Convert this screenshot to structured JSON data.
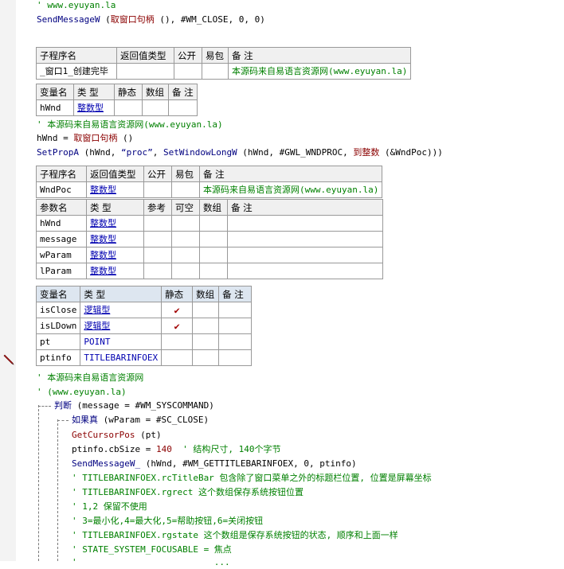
{
  "lines": {
    "l0": "' www.eyuyan.la",
    "l1a": "SendMessageW",
    "l1b": " (",
    "l1c": "取窗口句柄",
    "l1d": " (), ",
    "l1e": "#WM_CLOSE",
    "l1f": ", 0, 0)"
  },
  "table1": {
    "headers": [
      "子程序名",
      "返回值类型",
      "公开",
      "易包",
      "备 注"
    ],
    "name": "_窗口1_创建完毕",
    "note": "本源码来自易语言资源网(www.eyuyan.la)"
  },
  "vars1": {
    "headers": [
      "变量名",
      "类 型",
      "静态",
      "数组",
      "备 注"
    ],
    "rows": [
      {
        "name": "hWnd",
        "type": "整数型"
      }
    ]
  },
  "code2": {
    "c1": "' 本源码来自易语言资源网(www.eyuyan.la)",
    "c2a": "hWnd = ",
    "c2b": "取窗口句柄",
    "c2c": " ()",
    "c3a": "SetPropA",
    "c3b": " (hWnd, ",
    "c3c": "“proc”",
    "c3d": ", ",
    "c3e": "SetWindowLongW",
    "c3f": " (hWnd, ",
    "c3g": "#GWL_WNDPROC",
    "c3h": ", ",
    "c3i": "到整数",
    "c3j": " (&WndPoc)))"
  },
  "table2": {
    "headers": [
      "子程序名",
      "返回值类型",
      "公开",
      "易包",
      "备 注"
    ],
    "name": "WndPoc",
    "ret": "整数型",
    "note": "本源码来自易语言资源网(www.eyuyan.la)",
    "param_headers": [
      "参数名",
      "类 型",
      "参考",
      "可空",
      "数组",
      "备 注"
    ],
    "params": [
      {
        "name": "hWnd",
        "type": "整数型"
      },
      {
        "name": "message",
        "type": "整数型"
      },
      {
        "name": "wParam",
        "type": "整数型"
      },
      {
        "name": "lParam",
        "type": "整数型"
      }
    ]
  },
  "vars2": {
    "headers": [
      "变量名",
      "类 型",
      "静态",
      "数组",
      "备 注"
    ],
    "rows": [
      {
        "name": "isClose",
        "type": "逻辑型",
        "static": "✔"
      },
      {
        "name": "isLDown",
        "type": "逻辑型",
        "static": "✔"
      },
      {
        "name": "pt",
        "type": "POINT",
        "static": ""
      },
      {
        "name": "ptinfo",
        "type": "TITLEBARINFOEX",
        "static": ""
      }
    ]
  },
  "code3": {
    "a1": "' 本源码来自易语言资源网",
    "a2": "' (www.eyuyan.la)",
    "j1a": "判断",
    "j1b": " (message = ",
    "j1c": "#WM_SYSCOMMAND",
    "j1d": ")",
    "j2a": "如果真",
    "j2b": " (wParam = ",
    "j2c": "#SC_CLOSE",
    "j2d": ")",
    "s1": "GetCursorPos",
    "s1b": " (pt)",
    "s2a": "ptinfo.cbSize = ",
    "s2b": "140",
    "s2c": "  ' 结构尺寸, 140个字节",
    "s3a": "SendMessageW_",
    "s3b": " (hWnd, ",
    "s3c": "#WM_GETTITLEBARINFOEX",
    "s3d": ", 0, ptinfo)",
    "k1": "' TITLEBARINFOEX.rcTitleBar 包含除了窗口菜单之外的标题栏位置, 位置是屏幕坐标",
    "k2": "' TITLEBARINFOEX.rgrect 这个数组保存系统按钮位置",
    "k3": "' 1,2 保留不使用",
    "k4": "' 3=最小化,4=最大化,5=帮助按钮,6=关闭按钮",
    "k5": "' TITLEBARINFOEX.rgstate 这个数组是保存系统按钮的状态, 顺序和上面一样",
    "k6": "' STATE_SYSTEM_FOCUSABLE = 焦点",
    "k7": "'                          ..."
  },
  "colors": {
    "comment": "#008000",
    "keyword": "#000080",
    "constant": "#8b0000",
    "type": "#0000b0",
    "check": "#a00000"
  },
  "icons": {
    "gutter_marker": "pencil-icon"
  }
}
